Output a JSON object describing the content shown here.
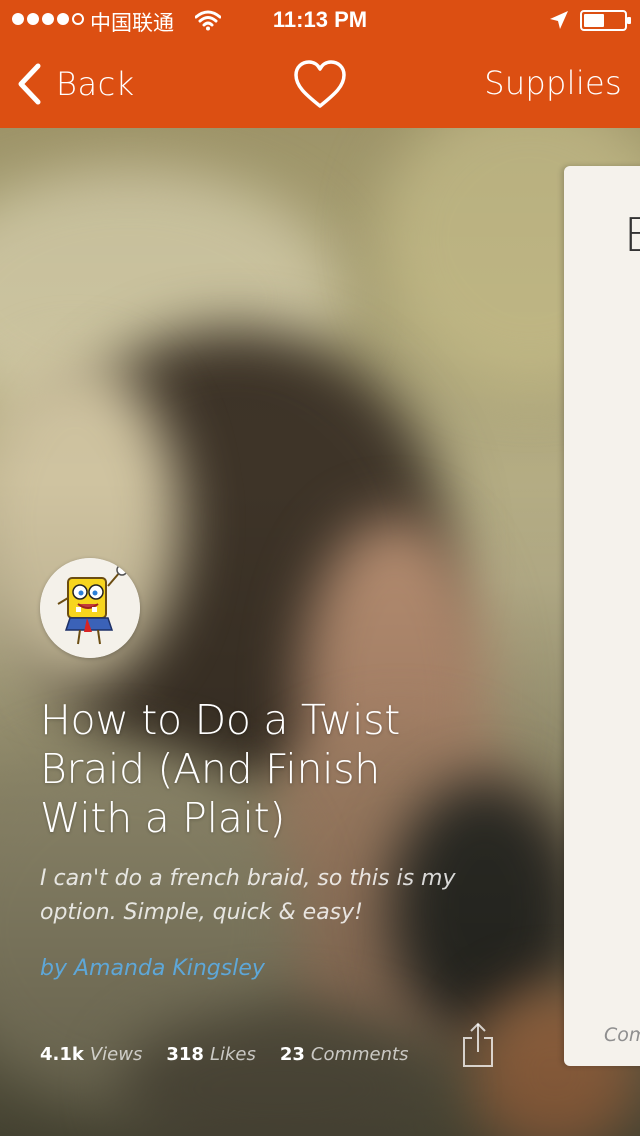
{
  "status_bar": {
    "carrier": "中国联通",
    "time": "11:13 PM",
    "signal_bars_filled": 4,
    "signal_bars_total": 5,
    "icons": [
      "wifi-icon",
      "location-icon",
      "battery-icon"
    ],
    "battery_level": 0.5
  },
  "nav": {
    "back_label": "Back",
    "center_icon": "heart-icon",
    "right_label": "Supplies"
  },
  "project": {
    "title": "How to Do a Twist Braid (And Finish With a Plait)",
    "description": "I can't do a french braid, so this is my option. Simple, quick & easy!",
    "author": "by Amanda Kingsley",
    "avatar_icon": "spongebob-avatar",
    "stats": {
      "views_value": "4.1k",
      "views_label": "Views",
      "likes_value": "318",
      "likes_label": "Likes",
      "comments_value": "23",
      "comments_label": "Comments"
    },
    "share_icon": "share-icon"
  },
  "next_card": {
    "peek_text": "E",
    "footer_text": "Com"
  },
  "colors": {
    "accent": "#dc4f12",
    "author_link": "#5ea7d8",
    "card_bg": "#f5f2ec"
  }
}
